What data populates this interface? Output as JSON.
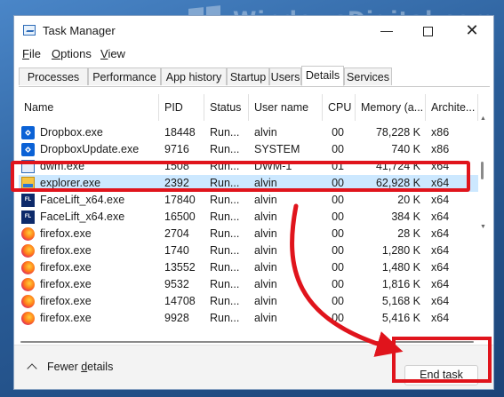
{
  "watermark": "WindowsDigital.com",
  "window": {
    "title": "Task Manager",
    "controls": {
      "minimize": "—",
      "close": "✕"
    }
  },
  "menu": [
    {
      "label": "File",
      "mnemonic": "F",
      "rest": "ile"
    },
    {
      "label": "Options",
      "mnemonic": "O",
      "rest": "ptions"
    },
    {
      "label": "View",
      "mnemonic": "V",
      "rest": "iew"
    }
  ],
  "tabs": [
    "Processes",
    "Performance",
    "App history",
    "Startup",
    "Users",
    "Details",
    "Services"
  ],
  "active_tab": "Details",
  "columns": [
    "Name",
    "PID",
    "Status",
    "User name",
    "CPU",
    "Memory (a...",
    "Archite..."
  ],
  "rows": [
    {
      "name": "Dropbox.exe",
      "pid": "18448",
      "status": "Run...",
      "user": "alvin",
      "cpu": "00",
      "memory": "78,228 K",
      "arch": "x86",
      "icon": "dropbox-icon"
    },
    {
      "name": "DropboxUpdate.exe",
      "pid": "9716",
      "status": "Run...",
      "user": "SYSTEM",
      "cpu": "00",
      "memory": "740 K",
      "arch": "x86",
      "icon": "dropbox-icon"
    },
    {
      "name": "dwm.exe",
      "pid": "1508",
      "status": "Run...",
      "user": "DWM-1",
      "cpu": "01",
      "memory": "41,724 K",
      "arch": "x64",
      "icon": "dwm-icon"
    },
    {
      "name": "explorer.exe",
      "pid": "2392",
      "status": "Run...",
      "user": "alvin",
      "cpu": "00",
      "memory": "62,928 K",
      "arch": "x64",
      "icon": "explorer-icon",
      "selected": true
    },
    {
      "name": "FaceLift_x64.exe",
      "pid": "17840",
      "status": "Run...",
      "user": "alvin",
      "cpu": "00",
      "memory": "20 K",
      "arch": "x64",
      "icon": "facelift-icon"
    },
    {
      "name": "FaceLift_x64.exe",
      "pid": "16500",
      "status": "Run...",
      "user": "alvin",
      "cpu": "00",
      "memory": "384 K",
      "arch": "x64",
      "icon": "facelift-icon"
    },
    {
      "name": "firefox.exe",
      "pid": "2704",
      "status": "Run...",
      "user": "alvin",
      "cpu": "00",
      "memory": "28 K",
      "arch": "x64",
      "icon": "firefox-icon"
    },
    {
      "name": "firefox.exe",
      "pid": "1740",
      "status": "Run...",
      "user": "alvin",
      "cpu": "00",
      "memory": "1,280 K",
      "arch": "x64",
      "icon": "firefox-icon"
    },
    {
      "name": "firefox.exe",
      "pid": "13552",
      "status": "Run...",
      "user": "alvin",
      "cpu": "00",
      "memory": "1,480 K",
      "arch": "x64",
      "icon": "firefox-icon"
    },
    {
      "name": "firefox.exe",
      "pid": "9532",
      "status": "Run...",
      "user": "alvin",
      "cpu": "00",
      "memory": "1,816 K",
      "arch": "x64",
      "icon": "firefox-icon"
    },
    {
      "name": "firefox.exe",
      "pid": "14708",
      "status": "Run...",
      "user": "alvin",
      "cpu": "00",
      "memory": "5,168 K",
      "arch": "x64",
      "icon": "firefox-icon"
    },
    {
      "name": "firefox.exe",
      "pid": "9928",
      "status": "Run...",
      "user": "alvin",
      "cpu": "00",
      "memory": "5,416 K",
      "arch": "x64",
      "icon": "firefox-icon"
    }
  ],
  "footer": {
    "fewer_details": "Fewer details",
    "fewer_mnemonic": "d",
    "end_task": "End task",
    "end_task_mnemonic": "E"
  },
  "colors": {
    "highlight": "#e0141c",
    "selection": "#cce8ff",
    "desktop": "#22508a"
  }
}
